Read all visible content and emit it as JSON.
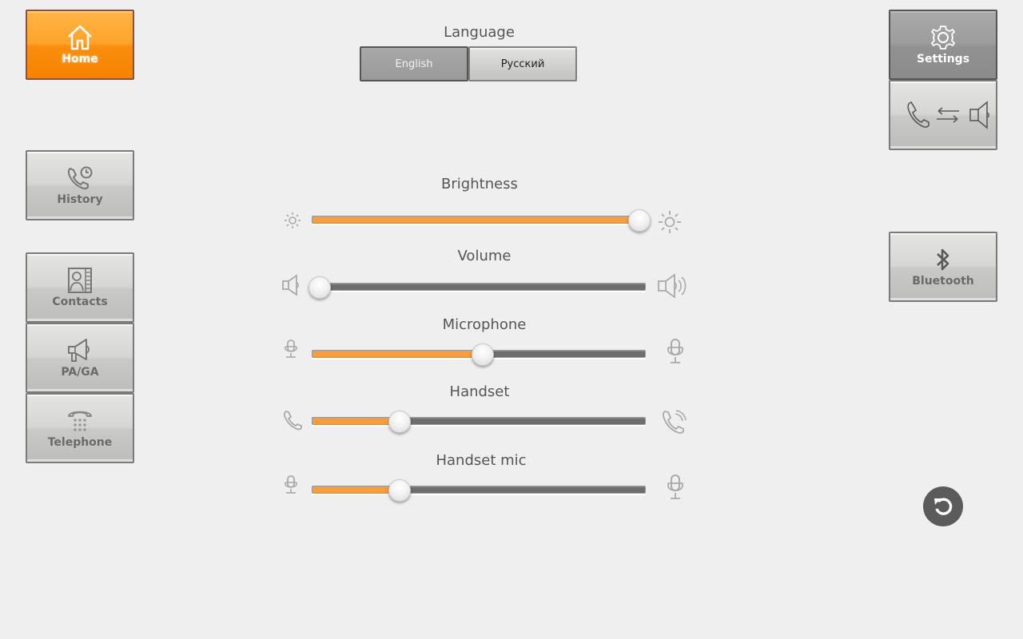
{
  "nav": {
    "home": {
      "label": "Home",
      "icon": "home-icon",
      "state": "selected"
    },
    "history": {
      "label": "History",
      "icon": "call-history-icon"
    },
    "contacts": {
      "label": "Contacts",
      "icon": "contacts-icon"
    },
    "paga": {
      "label": "PA/GA",
      "icon": "megaphone-icon"
    },
    "telephone": {
      "label": "Telephone",
      "icon": "telephone-keypad-icon"
    },
    "settings": {
      "label": "Settings",
      "icon": "gear-icon",
      "state": "active"
    },
    "audio_route": {
      "label": "",
      "icon": "phone-speaker-swap-icon"
    },
    "bluetooth": {
      "label": "Bluetooth",
      "icon": "bluetooth-icon"
    }
  },
  "language": {
    "title": "Language",
    "options": [
      {
        "label": "English",
        "selected": true
      },
      {
        "label": "Русский",
        "selected": false
      }
    ]
  },
  "sliders": [
    {
      "id": "brightness",
      "label": "Brightness",
      "value_percent": 98,
      "min_icon": "brightness-low-icon",
      "max_icon": "brightness-high-icon"
    },
    {
      "id": "volume",
      "label": "Volume",
      "value_percent": 2,
      "min_icon": "speaker-low-icon",
      "max_icon": "speaker-high-icon"
    },
    {
      "id": "microphone",
      "label": "Microphone",
      "value_percent": 51,
      "min_icon": "microphone-small-icon",
      "max_icon": "microphone-large-icon"
    },
    {
      "id": "handset",
      "label": "Handset",
      "value_percent": 26,
      "min_icon": "handset-low-icon",
      "max_icon": "handset-high-icon"
    },
    {
      "id": "handset_mic",
      "label": "Handset mic",
      "value_percent": 26,
      "min_icon": "microphone-small-icon",
      "max_icon": "microphone-large-icon"
    }
  ],
  "colors": {
    "accent": "#fa9c3a",
    "home_tile": "#ff9a1a",
    "background": "#efefef",
    "reset_button": "#5b5b5b"
  },
  "reset": {
    "icon": "reset-icon"
  }
}
